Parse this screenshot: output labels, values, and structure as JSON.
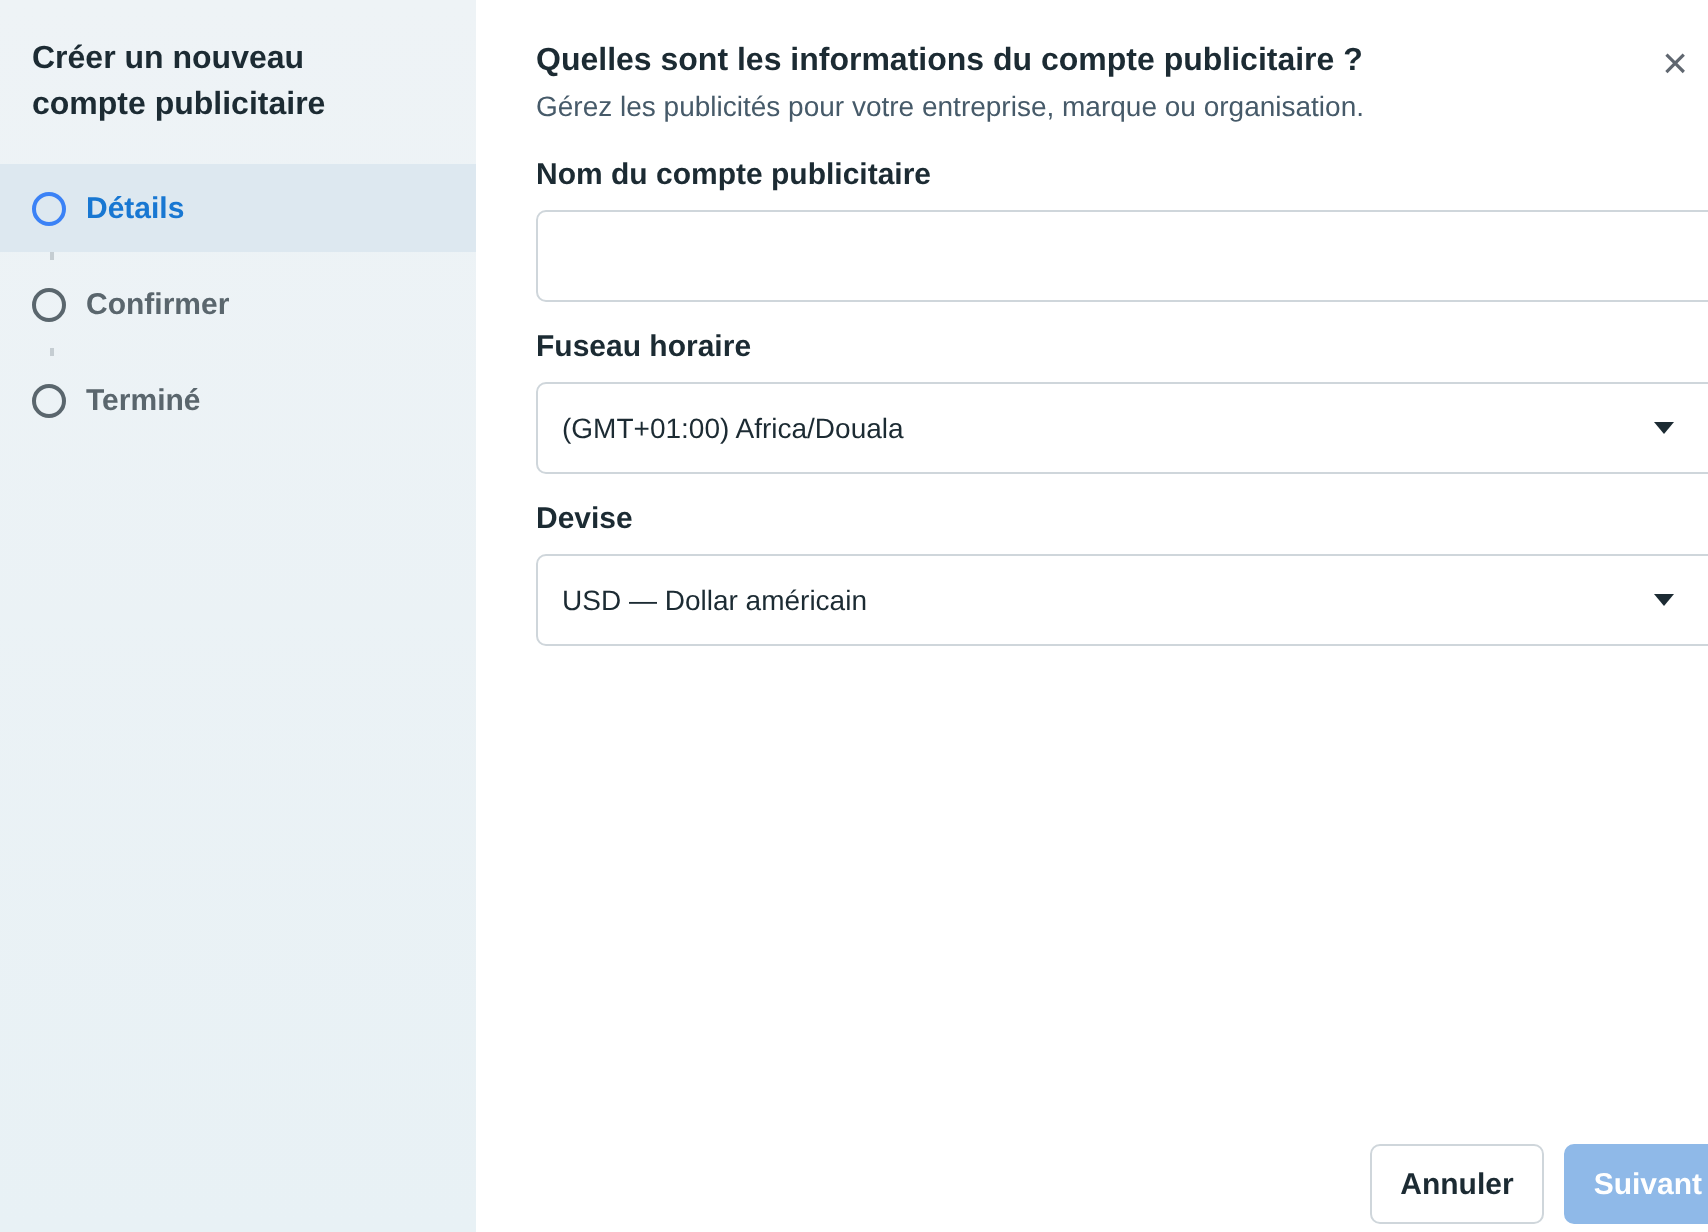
{
  "sidebar": {
    "title": "Créer un nouveau compte publicitaire",
    "steps": [
      {
        "label": "Détails",
        "selected": true
      },
      {
        "label": "Confirmer",
        "selected": false
      },
      {
        "label": "Terminé",
        "selected": false
      }
    ]
  },
  "dialog": {
    "title": "Quelles sont les informations du compte publicitaire ?",
    "close": "×",
    "subtitle": "Gérez les publicités pour votre entreprise, marque ou organisation.",
    "fields": [
      {
        "kind": "text",
        "label": "Nom du compte publicitaire"
      },
      {
        "kind": "select",
        "label": "Fuseau horaire",
        "value": "(GMT+01:00) Africa/Douala"
      },
      {
        "kind": "select",
        "label": "Devise",
        "value": "USD — Dollar américain"
      }
    ],
    "buttons": [
      {
        "label": "Annuler",
        "disabled": false
      },
      {
        "label": "Suivant",
        "disabled": true
      }
    ]
  }
}
